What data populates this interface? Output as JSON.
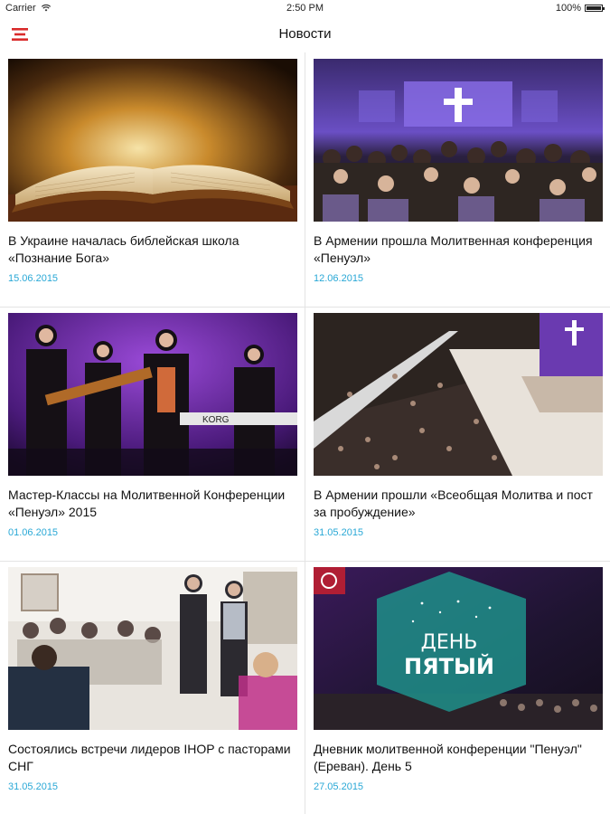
{
  "status_bar": {
    "carrier": "Carrier",
    "time": "2:50 PM",
    "battery": "100%"
  },
  "nav": {
    "title": "Новости",
    "menu_icon": "menu-icon",
    "accent": "#d92b2b"
  },
  "colors": {
    "date": "#29a8d6"
  },
  "articles": [
    {
      "title": "В Украине началась библейская школа «Познание Бога»",
      "date": "15.06.2015"
    },
    {
      "title": "В Армении прошла Молитвенная конференция «Пенуэл»",
      "date": "12.06.2015"
    },
    {
      "title": "Мастер-Классы на Молитвенной Конференции «Пенуэл» 2015",
      "date": "01.06.2015"
    },
    {
      "title": "В Армении прошли «Всеобщая Молитва и пост за пробуждение»",
      "date": "31.05.2015"
    },
    {
      "title": "Состоялись встречи лидеров IHOP с пасторами СНГ",
      "date": "31.05.2015"
    },
    {
      "title": "Дневник молитвенной конференции \"Пенуэл\" (Ереван). День 5",
      "date": "27.05.2015"
    }
  ],
  "overlay_text": {
    "day_line1": "ДЕНЬ",
    "day_line2": "ПЯТЫЙ"
  }
}
